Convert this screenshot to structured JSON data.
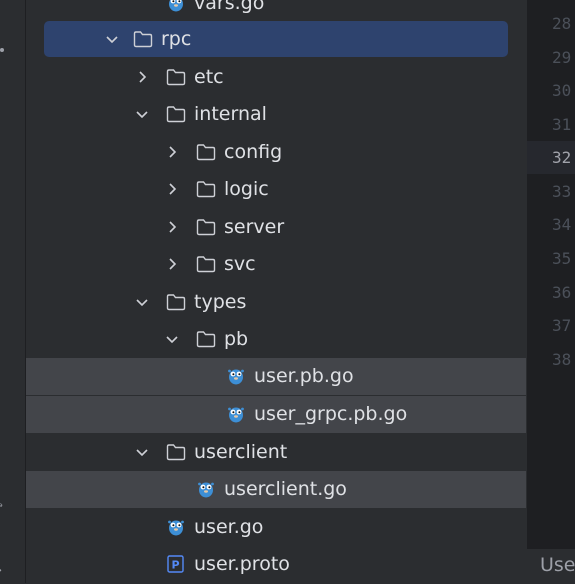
{
  "project_tree": {
    "items": [
      {
        "label": "vars.go",
        "type": "go-file"
      },
      {
        "label": "rpc",
        "type": "folder",
        "expanded": true,
        "selected": true
      },
      {
        "label": "etc",
        "type": "folder",
        "expanded": false
      },
      {
        "label": "internal",
        "type": "folder",
        "expanded": true
      },
      {
        "label": "config",
        "type": "folder",
        "expanded": false
      },
      {
        "label": "logic",
        "type": "folder",
        "expanded": false
      },
      {
        "label": "server",
        "type": "folder",
        "expanded": false
      },
      {
        "label": "svc",
        "type": "folder",
        "expanded": false
      },
      {
        "label": "types",
        "type": "folder",
        "expanded": true
      },
      {
        "label": "pb",
        "type": "folder",
        "expanded": true
      },
      {
        "label": "user.pb.go",
        "type": "go-file"
      },
      {
        "label": "user_grpc.pb.go",
        "type": "go-file"
      },
      {
        "label": "userclient",
        "type": "folder",
        "expanded": true
      },
      {
        "label": "userclient.go",
        "type": "go-file"
      },
      {
        "label": "user.go",
        "type": "go-file"
      },
      {
        "label": "user.proto",
        "type": "proto-file",
        "icon_letter": "P"
      }
    ]
  },
  "editor": {
    "line_numbers": [
      "28",
      "29",
      "30",
      "31",
      "32",
      "33",
      "34",
      "35",
      "36",
      "37",
      "38"
    ],
    "current_line": "32"
  },
  "status_bar": {
    "text": "Use"
  },
  "colors": {
    "panel_bg": "#2b2d30",
    "editor_bg": "#1e1f22",
    "selection": "#2e436e",
    "highlight": "#43454a",
    "folder_stroke": "#ced0d6",
    "gopher": "#3d8fd6",
    "proto_icon": "#548af7"
  }
}
